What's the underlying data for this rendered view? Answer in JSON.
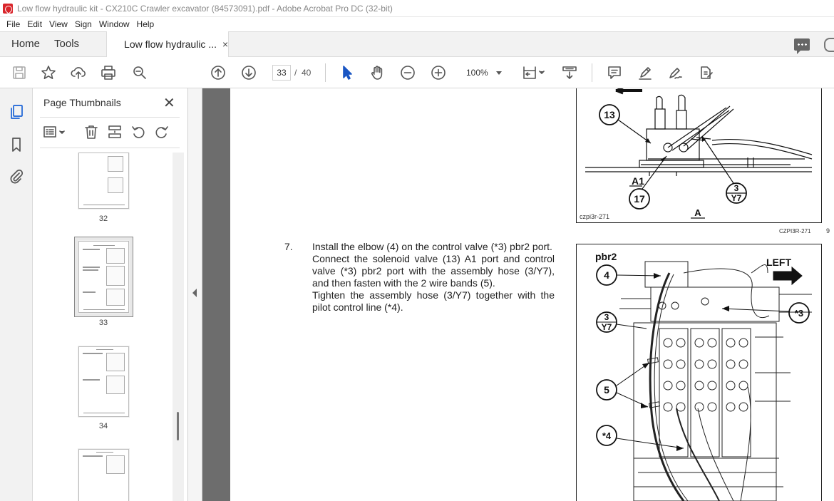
{
  "window": {
    "title": "Low flow hydraulic kit - CX210C Crawler excavator (84573091).pdf - Adobe Acrobat Pro DC (32-bit)"
  },
  "menu": [
    "File",
    "Edit",
    "View",
    "Sign",
    "Window",
    "Help"
  ],
  "tabs": {
    "home": "Home",
    "tools": "Tools",
    "document": "Low flow hydraulic ...",
    "close": "×"
  },
  "toolbar": {
    "current_page": "33",
    "page_sep": "/",
    "total_pages": "40",
    "zoom": "100%"
  },
  "panel": {
    "title": "Page Thumbnails",
    "close": "✕",
    "thumbnails": [
      {
        "label": "32"
      },
      {
        "label": "33",
        "selected": true
      },
      {
        "label": "34"
      }
    ]
  },
  "document": {
    "step_number": "7.",
    "step_paragraphs": [
      "Install the elbow (4) on the control valve (*3) pbr2 port.",
      "Connect the solenoid valve (13) A1 port and control valve (*3) pbr2 port with the assembly hose (3/Y7), and then fasten with the 2 wire bands (5).",
      "Tighten the assembly hose (3/Y7) together with the pilot control line (*4)."
    ],
    "figure_top": {
      "callouts": [
        "13",
        "17",
        "3",
        "Y7"
      ],
      "label_a1": "A1",
      "label_a": "A",
      "code_inner": "czpi3r-271",
      "code_outer": "CZPI3R-271",
      "page_mark": "9"
    },
    "figure_bottom": {
      "port_label": "pbr2",
      "direction_label": "LEFT",
      "callouts": [
        "4",
        "*3",
        "3",
        "Y7",
        "5",
        "*4"
      ]
    }
  }
}
